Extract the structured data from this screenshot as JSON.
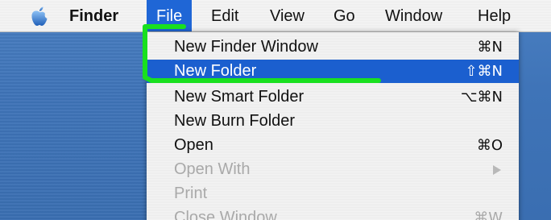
{
  "menubar": {
    "apple_icon": "apple-icon",
    "titles": [
      "Finder",
      "File",
      "Edit",
      "View",
      "Go",
      "Window",
      "Help"
    ]
  },
  "file_menu": {
    "items": [
      {
        "label": "New Finder Window",
        "shortcut": "⌘N"
      },
      {
        "label": "New Folder",
        "shortcut": "⇧⌘N"
      },
      {
        "label": "New Smart Folder",
        "shortcut": "⌥⌘N"
      },
      {
        "label": "New Burn Folder",
        "shortcut": ""
      },
      {
        "label": "Open",
        "shortcut": "⌘O"
      },
      {
        "label": "Open With",
        "shortcut": ""
      },
      {
        "label": "Print",
        "shortcut": ""
      },
      {
        "label": "Close Window",
        "shortcut": "⌘W"
      }
    ]
  },
  "colors": {
    "selection": "#1b5fcf",
    "annotation": "#19e01f",
    "desktop": "#4079bd"
  }
}
